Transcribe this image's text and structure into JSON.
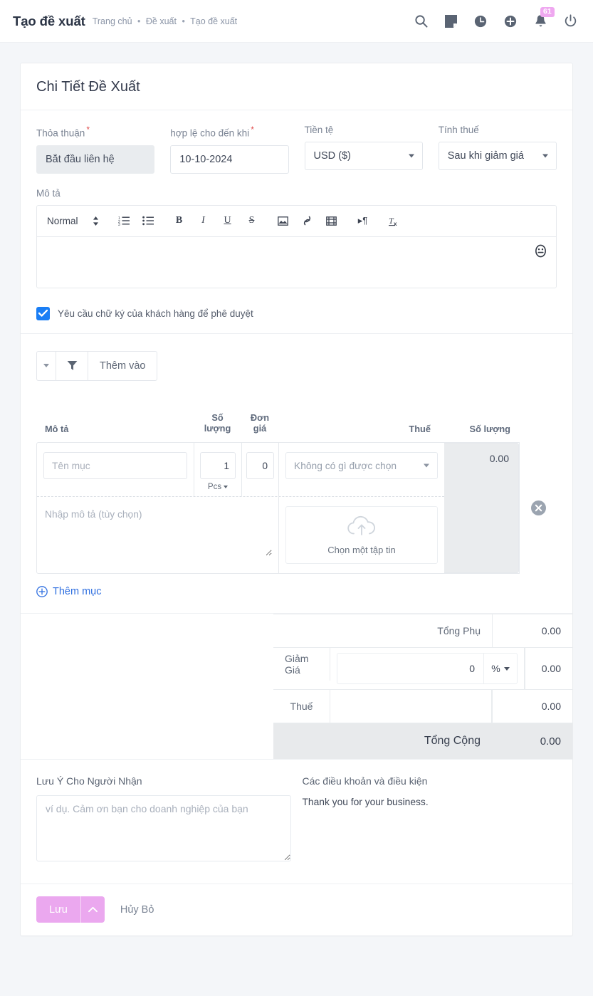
{
  "topbar": {
    "title": "Tạo đề xuất",
    "breadcrumb": [
      "Trang chủ",
      "Đề xuất",
      "Tạo đề xuất"
    ],
    "separator": "•",
    "icons": [
      "search-icon",
      "note-icon",
      "clock-icon",
      "plus-circle-icon",
      "bell-icon",
      "power-icon"
    ],
    "notification_count": "61",
    "badge_color": "#efa8f0"
  },
  "card": {
    "title": "Chi Tiết Đề Xuất"
  },
  "form": {
    "agreement": {
      "label": "Thỏa thuận",
      "required": "*",
      "value": "Bắt đầu liên hệ"
    },
    "valid_until": {
      "label": "hợp lệ cho đến khi",
      "required": "*",
      "value": "10-10-2024"
    },
    "currency": {
      "label": "Tiền tệ",
      "value": "USD ($)"
    },
    "tax_calc": {
      "label": "Tính thuế",
      "value": "Sau khi giảm giá"
    }
  },
  "description": {
    "label": "Mô tả",
    "toolbar": {
      "format": "Normal",
      "buttons": [
        "ordered-list",
        "bullet-list",
        "bold",
        "italic",
        "underline",
        "strikethrough",
        "image",
        "link",
        "video",
        "direction",
        "clear-format"
      ]
    },
    "content": "",
    "emoji": "emoji-icon"
  },
  "signature": {
    "checked": true,
    "label": "Yêu cầu chữ ký của khách hàng để phê duyệt"
  },
  "filterbar": {
    "caret": "chevron-down-icon",
    "filter_icon": "funnel-icon",
    "add_label": "Thêm vào"
  },
  "items_table": {
    "headers": {
      "description": "Mô tả",
      "quantity": "Số\nlượng",
      "quantity_line1": "Số",
      "quantity_line2": "lượng",
      "rate_line1": "Đơn",
      "rate_line2": "giá",
      "tax": "Thuế",
      "amount": "Số lượng"
    },
    "rows": [
      {
        "item_placeholder": "Tên mục",
        "item_value": "",
        "quantity": "1",
        "unit": "Pcs",
        "rate": "0",
        "tax": "Không có gì được chọn",
        "amount": "0.00",
        "notes_placeholder": "Nhập mô tả (tùy chọn)",
        "notes_value": "",
        "file_label": "Chọn một tập tin",
        "delete_icon": "close-circle-icon"
      }
    ],
    "add_item_label": "Thêm mục"
  },
  "totals": {
    "subtotal_label": "Tổng Phụ",
    "subtotal_value": "0.00",
    "discount_label": "Giảm Giá",
    "discount_value": "0",
    "discount_unit": "%",
    "discount_amount": "0.00",
    "tax_label": "Thuế",
    "tax_value": "0.00",
    "grand_label": "Tổng Cộng",
    "grand_value": "0.00"
  },
  "notes": {
    "client_note_label": "Lưu Ý Cho Người Nhận",
    "client_note_placeholder": "ví dụ. Cảm ơn bạn cho doanh nghiệp của bạn",
    "client_note_value": "",
    "terms_label": "Các điều khoản và điều kiện",
    "terms_text": "Thank you for your business."
  },
  "footer": {
    "save_label": "Lưu",
    "save_caret": "chevron-up-icon",
    "cancel_label": "Hủy Bỏ",
    "save_color": "#eba8ef"
  }
}
